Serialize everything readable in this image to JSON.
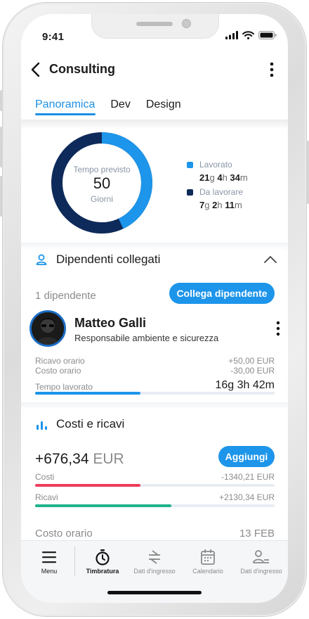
{
  "status": {
    "time": "9:41"
  },
  "header": {
    "title": "Consulting"
  },
  "tabs": [
    {
      "label": "Panoramica"
    },
    {
      "label": "Dev"
    },
    {
      "label": "Design"
    }
  ],
  "overview": {
    "center_label": "Tempo previsto",
    "center_value": "50",
    "center_unit": "Giorni",
    "worked_fraction": 0.43,
    "colors": {
      "worked": "#1d95ea",
      "remaining": "#0e2a5a"
    },
    "legend": [
      {
        "label": "Lavorato",
        "d": "21",
        "d_u": "g",
        "h": "4",
        "h_u": "h",
        "m": "34",
        "m_u": "m"
      },
      {
        "label": "Da lavorare",
        "d": "7",
        "d_u": "g",
        "h": "2",
        "h_u": "h",
        "m": "11",
        "m_u": "m"
      }
    ]
  },
  "employees": {
    "section_title": "Dipendenti collegati",
    "count_label": "1 dipendente",
    "link_button": "Collega dipendente",
    "person": {
      "name": "Matteo Galli",
      "role": "Responsabile ambiente e sicurezza",
      "rows": [
        {
          "label": "Ricavo orario",
          "value": "+50,00 EUR"
        },
        {
          "label": "Costo orario",
          "value": "-30,00 EUR"
        }
      ],
      "time_label": "Tempo lavorato",
      "time_value": "16g 3h 42m",
      "time_fraction": 0.44
    }
  },
  "costs": {
    "section_title": "Costi e ricavi",
    "total_value": "+676,34",
    "total_currency": "EUR",
    "add_button": "Aggiungi",
    "costs_label": "Costi",
    "costs_value": "-1340,21 EUR",
    "costs_fraction": 0.44,
    "revenue_label": "Ricavi",
    "revenue_value": "+2130,34 EUR",
    "revenue_fraction": 0.57,
    "colors": {
      "costs": "#ee3e5c",
      "revenue": "#1fb38a"
    },
    "next_label": "Costo orario",
    "next_date": "13 FEB"
  },
  "nav": [
    {
      "label": "Menu",
      "icon": "menu-icon"
    },
    {
      "label": "Timbratura",
      "icon": "stopwatch-icon"
    },
    {
      "label": "Dati d'ingresso",
      "icon": "swap-icon"
    },
    {
      "label": "Calendario",
      "icon": "calendar-icon"
    },
    {
      "label": "Dati d'ingresso",
      "icon": "users-icon"
    }
  ]
}
